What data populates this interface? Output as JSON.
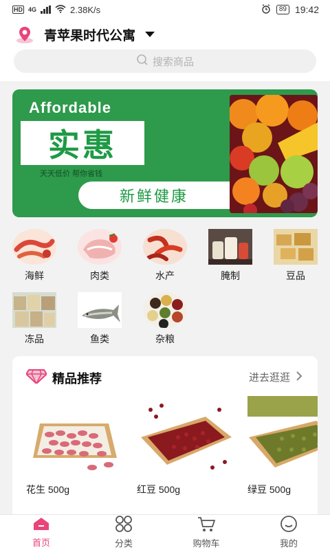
{
  "status_bar": {
    "hd": "HD",
    "net": "4G",
    "speed": "2.38K/s",
    "battery": "89",
    "time": "19:42"
  },
  "header": {
    "location_title": "青苹果时代公寓",
    "search_placeholder": "搜索商品"
  },
  "banner": {
    "headline_en": "Affordable",
    "headline_cn": "实惠",
    "subtext": "天天低价  帮你省钱",
    "pill_text": "新鲜健康"
  },
  "categories": [
    {
      "label": "海鲜"
    },
    {
      "label": "肉类"
    },
    {
      "label": "水产"
    },
    {
      "label": "腌制"
    },
    {
      "label": "豆品"
    },
    {
      "label": "冻品"
    },
    {
      "label": "鱼类"
    },
    {
      "label": "杂粮"
    }
  ],
  "recommend": {
    "title": "精品推荐",
    "more_label": "进去逛逛",
    "products": [
      {
        "name": "花生 500g"
      },
      {
        "name": "红豆 500g"
      },
      {
        "name": "绿豆 500g"
      }
    ]
  },
  "tabbar": {
    "items": [
      {
        "label": "首页"
      },
      {
        "label": "分类"
      },
      {
        "label": "购物车"
      },
      {
        "label": "我的"
      }
    ]
  },
  "colors": {
    "accent": "#e8457a",
    "banner_green": "#2e9a4c"
  }
}
